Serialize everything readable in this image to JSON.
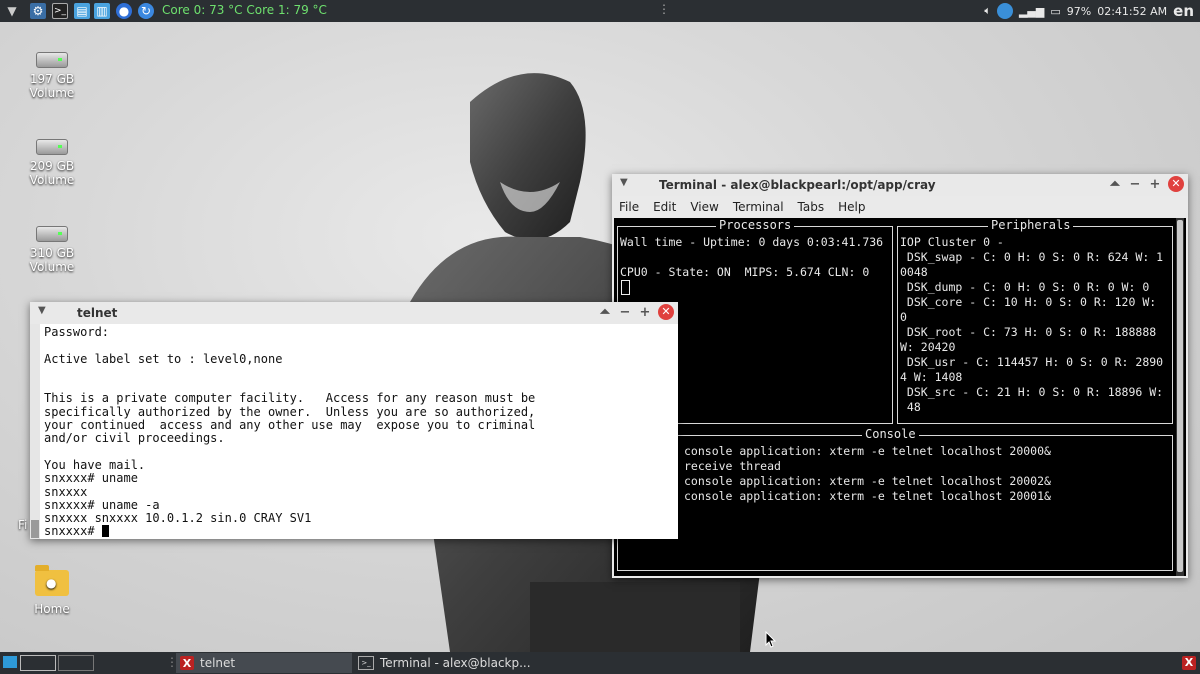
{
  "top_panel": {
    "temps": "Core 0: 73 °C  Core 1: 79 °C",
    "battery": "97%",
    "clock": "02:41:52 AM",
    "lang": "en",
    "launcher_icons": [
      "start-menu-icon",
      "settings-icon",
      "terminal-icon",
      "editor-icon",
      "file-manager-icon",
      "browser-icon",
      "refresh-icon"
    ]
  },
  "desktop": {
    "icons": [
      {
        "label_line1": "197 GB",
        "label_line2": "Volume"
      },
      {
        "label_line1": "209 GB",
        "label_line2": "Volume"
      },
      {
        "label_line1": "310 GB",
        "label_line2": "Volume"
      },
      {
        "label_line1": "Home",
        "label_line2": ""
      }
    ],
    "partial_label": "Fi"
  },
  "telnet_window": {
    "title": "telnet",
    "lines": [
      "Password:",
      "",
      "Active label set to : level0,none",
      "",
      "",
      "This is a private computer facility.   Access for any reason must be",
      "specifically authorized by the owner.  Unless you are so authorized,",
      "your continued  access and any other use may  expose you to criminal",
      "and/or civil proceedings.",
      "",
      "You have mail.",
      "snxxxx# uname",
      "snxxxx",
      "snxxxx# uname -a",
      "snxxxx snxxxx 10.0.1.2 sin.0 CRAY SV1"
    ],
    "prompt": "snxxxx# "
  },
  "terminal_window": {
    "title": "Terminal - alex@blackpearl:/opt/app/cray",
    "menu": [
      "File",
      "Edit",
      "View",
      "Terminal",
      "Tabs",
      "Help"
    ],
    "processors": {
      "label": "Processors",
      "text": "Wall time - Uptime: 0 days 0:03:41.736\n\nCPU0 - State: ON  MIPS: 5.674 CLN: 0"
    },
    "peripherals": {
      "label": "Peripherals",
      "text": "IOP Cluster 0 -\n DSK_swap - C: 0 H: 0 S: 0 R: 624 W: 1\n0048\n DSK_dump - C: 0 H: 0 S: 0 R: 0 W: 0\n DSK_core - C: 10 H: 0 S: 0 R: 120 W:\n0\n DSK_root - C: 73 H: 0 S: 0 R: 188888\nW: 20420\n DSK_usr - C: 114457 H: 0 S: 0 R: 2890\n4 W: 1408\n DSK_src - C: 21 H: 0 S: 0 R: 18896 W:\n 48"
    },
    "console": {
      "label": "Console",
      "text": "console application: xterm -e telnet localhost 20000&\nreceive thread\nconsole application: xterm -e telnet localhost 20002&\nconsole application: xterm -e telnet localhost 20001&"
    }
  },
  "taskbar": {
    "tasks": [
      {
        "label": "telnet",
        "icon": "x11-icon"
      },
      {
        "label": "Terminal - alex@blackp...",
        "icon": "terminal-icon"
      }
    ]
  },
  "colors": {
    "panel_bg": "#2b2f33",
    "temps_fg": "#6ee06e",
    "close_btn": "#e0413e"
  }
}
